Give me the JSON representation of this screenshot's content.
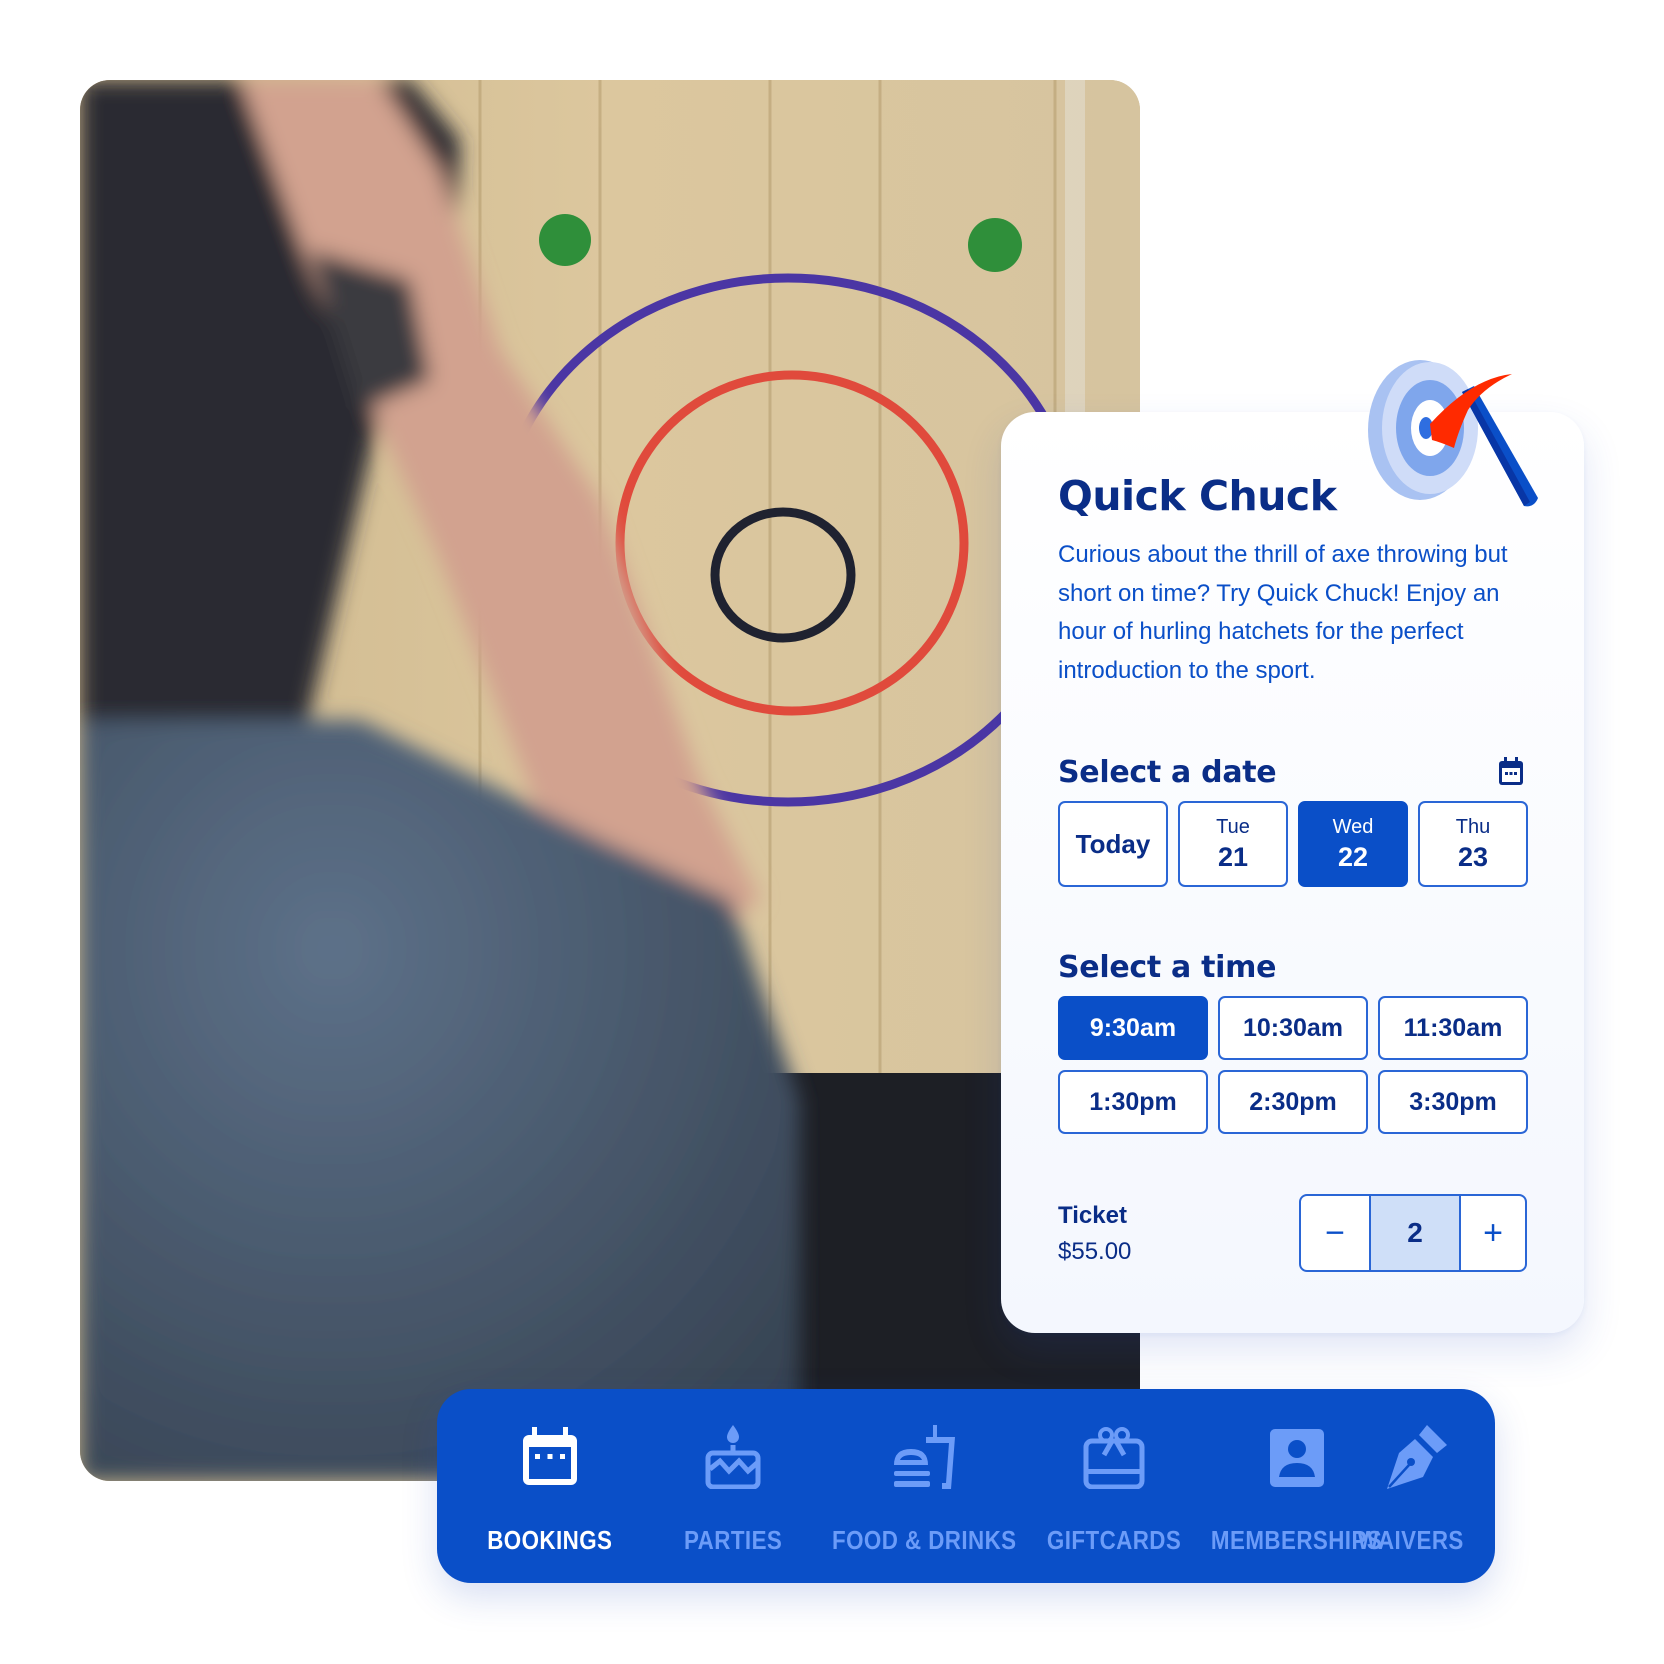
{
  "photo": {
    "alt": "Person throwing an axe at a wooden target with blue, red and black rings"
  },
  "card": {
    "title": "Quick Chuck",
    "description": "Curious about the thrill of axe throwing but short on time? Try Quick Chuck! Enjoy an hour of hurling hatchets for the perfect introduction to the sport.",
    "illustration_icon": "target-with-axe-icon",
    "date_section": {
      "label": "Select a date",
      "icon": "calendar-icon",
      "options": [
        {
          "label": "Today",
          "dow": "",
          "day": "",
          "selected": false
        },
        {
          "label": "",
          "dow": "Tue",
          "day": "21",
          "selected": false
        },
        {
          "label": "",
          "dow": "Wed",
          "day": "22",
          "selected": true
        },
        {
          "label": "",
          "dow": "Thu",
          "day": "23",
          "selected": false
        }
      ]
    },
    "time_section": {
      "label": "Select a time",
      "options": [
        {
          "label": "9:30am",
          "selected": true
        },
        {
          "label": "10:30am",
          "selected": false
        },
        {
          "label": "11:30am",
          "selected": false
        },
        {
          "label": "1:30pm",
          "selected": false
        },
        {
          "label": "2:30pm",
          "selected": false
        },
        {
          "label": "3:30pm",
          "selected": false
        }
      ]
    },
    "ticket": {
      "label": "Ticket",
      "price": "$55.00",
      "quantity": "2",
      "decrement_symbol": "−",
      "increment_symbol": "+"
    }
  },
  "nav": {
    "items": [
      {
        "label": "BOOKINGS",
        "icon": "calendar-icon",
        "active": true
      },
      {
        "label": "PARTIES",
        "icon": "birthday-cake-icon",
        "active": false
      },
      {
        "label": "FOOD & DRINKS",
        "icon": "burger-drink-icon",
        "active": false
      },
      {
        "label": "GIFTCARDS",
        "icon": "gift-card-icon",
        "active": false
      },
      {
        "label": "MEMBERSHIPS",
        "icon": "member-badge-icon",
        "active": false
      },
      {
        "label": "WAIVERS",
        "icon": "fountain-pen-icon",
        "active": false
      }
    ]
  },
  "colors": {
    "primary": "#0a4fc8",
    "heading": "#0a2d87",
    "nav_inactive": "#6c9cf8",
    "stepper_value_bg": "#cfdff8",
    "axe_head": "#ff2a00"
  }
}
